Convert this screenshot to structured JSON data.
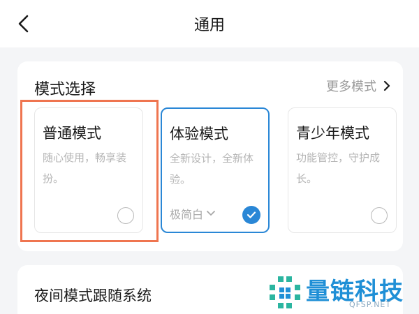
{
  "header": {
    "title": "通用",
    "back_icon": "chevron-left-icon"
  },
  "mode_section": {
    "title": "模式选择",
    "more_label": "更多模式",
    "more_icon": "chevron-right-icon",
    "options": [
      {
        "name": "普通模式",
        "description": "随心使用，畅享装扮。",
        "selected": false
      },
      {
        "name": "体验模式",
        "description": "全新设计，全新体验。",
        "theme_label": "极简白",
        "selected": true
      },
      {
        "name": "青少年模式",
        "description": "功能管控，守护成长。",
        "selected": false
      }
    ]
  },
  "night_section": {
    "label": "夜间模式跟随系统"
  },
  "watermark": {
    "name": "量链科技",
    "url": "QFSP.NET"
  },
  "colors": {
    "accent": "#2a87d6",
    "highlight": "#ef7550",
    "background": "#f4f5f7",
    "muted_text": "#b5b5b5"
  }
}
